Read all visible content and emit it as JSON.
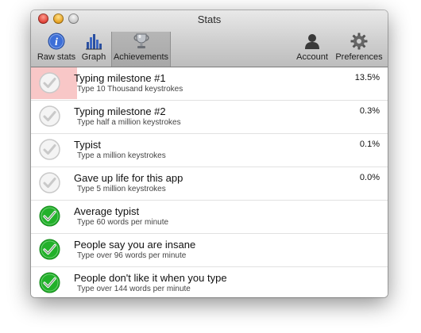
{
  "window": {
    "title": "Stats"
  },
  "toolbar": {
    "raw_stats": "Raw stats",
    "graph": "Graph",
    "achievements": "Achievements",
    "account": "Account",
    "preferences": "Preferences",
    "selected": "achievements"
  },
  "achievements": [
    {
      "title": "Typing milestone #1",
      "subtitle": "Type 10 Thousand keystrokes",
      "percent": "13.5%",
      "completed": false,
      "highlighted": true
    },
    {
      "title": "Typing milestone #2",
      "subtitle": "Type half a million keystrokes",
      "percent": "0.3%",
      "completed": false
    },
    {
      "title": "Typist",
      "subtitle": "Type a million keystrokes",
      "percent": "0.1%",
      "completed": false
    },
    {
      "title": "Gave up life for this app",
      "subtitle": "Type 5 million keystrokes",
      "percent": "0.0%",
      "completed": false
    },
    {
      "title": "Average typist",
      "subtitle": "Type 60 words per minute",
      "percent": "",
      "completed": true
    },
    {
      "title": "People say you are insane",
      "subtitle": "Type over 96 words per minute",
      "percent": "",
      "completed": true
    },
    {
      "title": "People don't like it when you type",
      "subtitle": "Type over 144 words per minute",
      "percent": "",
      "completed": true
    }
  ],
  "colors": {
    "complete": "#22b12a",
    "incomplete": "#c9c9c9",
    "highlight": "#f8c7c7"
  },
  "icons": {
    "raw_stats": "info-icon",
    "graph": "bar-chart-icon",
    "achievements": "trophy-icon",
    "account": "user-icon",
    "preferences": "gear-icon"
  }
}
